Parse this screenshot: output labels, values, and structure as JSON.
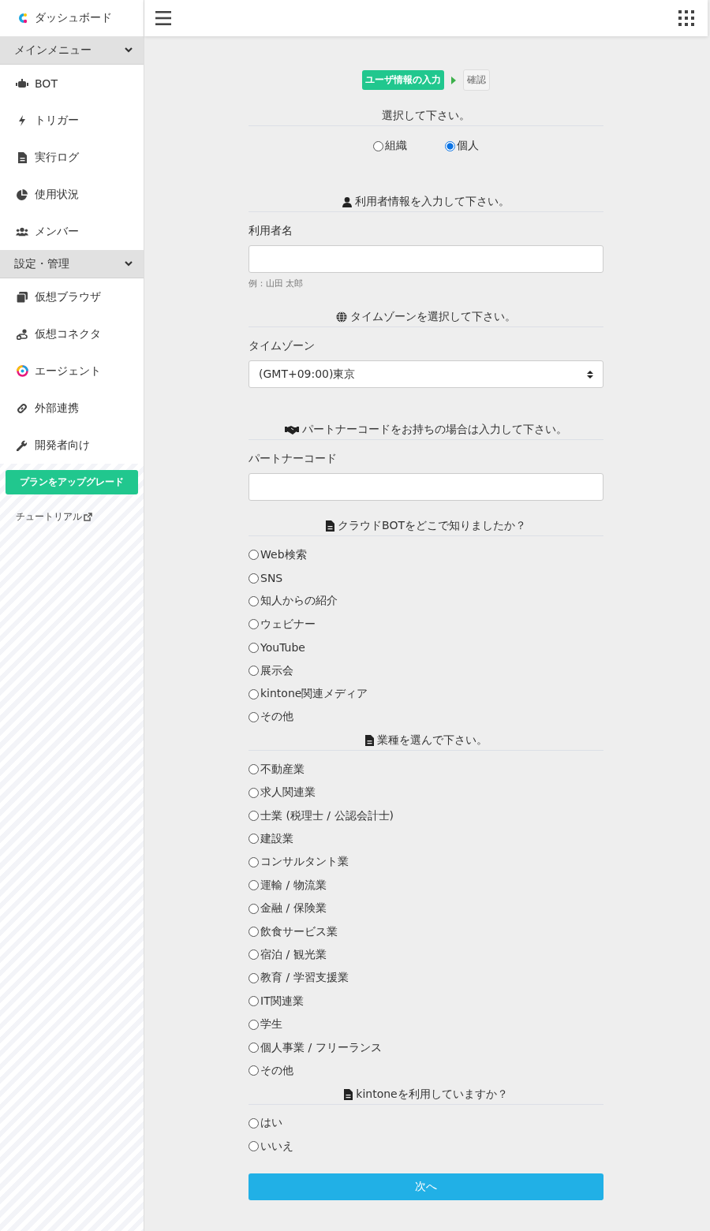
{
  "sidebar": {
    "top_item": {
      "label": "ダッシュボード"
    },
    "groups": [
      {
        "title": "メインメニュー",
        "expanded": true,
        "items": [
          {
            "label": "BOT"
          },
          {
            "label": "トリガー"
          },
          {
            "label": "実行ログ"
          },
          {
            "label": "使用状況"
          },
          {
            "label": "メンバー"
          }
        ]
      },
      {
        "title": "設定・管理",
        "expanded": true,
        "items": [
          {
            "label": "仮想ブラウザ"
          },
          {
            "label": "仮想コネクタ"
          },
          {
            "label": "エージェント"
          },
          {
            "label": "外部連携"
          },
          {
            "label": "開発者向け"
          }
        ]
      }
    ],
    "upgrade_button": "プランをアップグレード",
    "tutorial_link": "チュートリアル"
  },
  "steps": [
    {
      "label": "ユーザ情報の入力",
      "selected": true
    },
    {
      "label": "確認",
      "selected": false
    }
  ],
  "sections": [
    {
      "kind": "inline-choice",
      "heading": "選択して下さい。",
      "options": [
        {
          "label": "組織",
          "selected": false
        },
        {
          "label": "個人",
          "selected": true
        }
      ]
    },
    {
      "kind": "text",
      "heading": "利用者情報を入力して下さい。",
      "label": "利用者名",
      "hint": "例：山田 太郎"
    },
    {
      "kind": "select",
      "heading": "タイムゾーンを選択して下さい。",
      "label": "タイムゾーン",
      "value": "(GMT+09:00)東京"
    },
    {
      "kind": "text",
      "heading": "パートナーコードをお持ちの場合は入力して下さい。",
      "label": "パートナーコード"
    },
    {
      "kind": "list-choice",
      "heading": "クラウドBOTをどこで知りましたか？",
      "options": [
        {
          "label": "Web検索",
          "selected": false
        },
        {
          "label": "SNS",
          "selected": false
        },
        {
          "label": "知人からの紹介",
          "selected": false
        },
        {
          "label": "ウェビナー",
          "selected": false
        },
        {
          "label": "YouTube",
          "selected": false
        },
        {
          "label": "展示会",
          "selected": false
        },
        {
          "label": "kintone関連メディア",
          "selected": false
        },
        {
          "label": "その他",
          "selected": false
        }
      ]
    },
    {
      "kind": "list-choice",
      "heading": "業種を選んで下さい。",
      "options": [
        {
          "label": "不動産業",
          "selected": false
        },
        {
          "label": "求人関連業",
          "selected": false
        },
        {
          "label": "士業 (税理士 / 公認会計士)",
          "selected": false
        },
        {
          "label": "建設業",
          "selected": false
        },
        {
          "label": "コンサルタント業",
          "selected": false
        },
        {
          "label": "運輸 / 物流業",
          "selected": false
        },
        {
          "label": "金融 / 保険業",
          "selected": false
        },
        {
          "label": "飲食サービス業",
          "selected": false
        },
        {
          "label": "宿泊 / 観光業",
          "selected": false
        },
        {
          "label": "教育 / 学習支援業",
          "selected": false
        },
        {
          "label": "IT関連業",
          "selected": false
        },
        {
          "label": "学生",
          "selected": false
        },
        {
          "label": "個人事業 / フリーランス",
          "selected": false
        },
        {
          "label": "その他",
          "selected": false
        }
      ]
    },
    {
      "kind": "list-choice",
      "heading": "kintoneを利用していますか？",
      "options": [
        {
          "label": "はい",
          "selected": false
        },
        {
          "label": "いいえ",
          "selected": false
        }
      ]
    }
  ],
  "submit_button": "次へ"
}
